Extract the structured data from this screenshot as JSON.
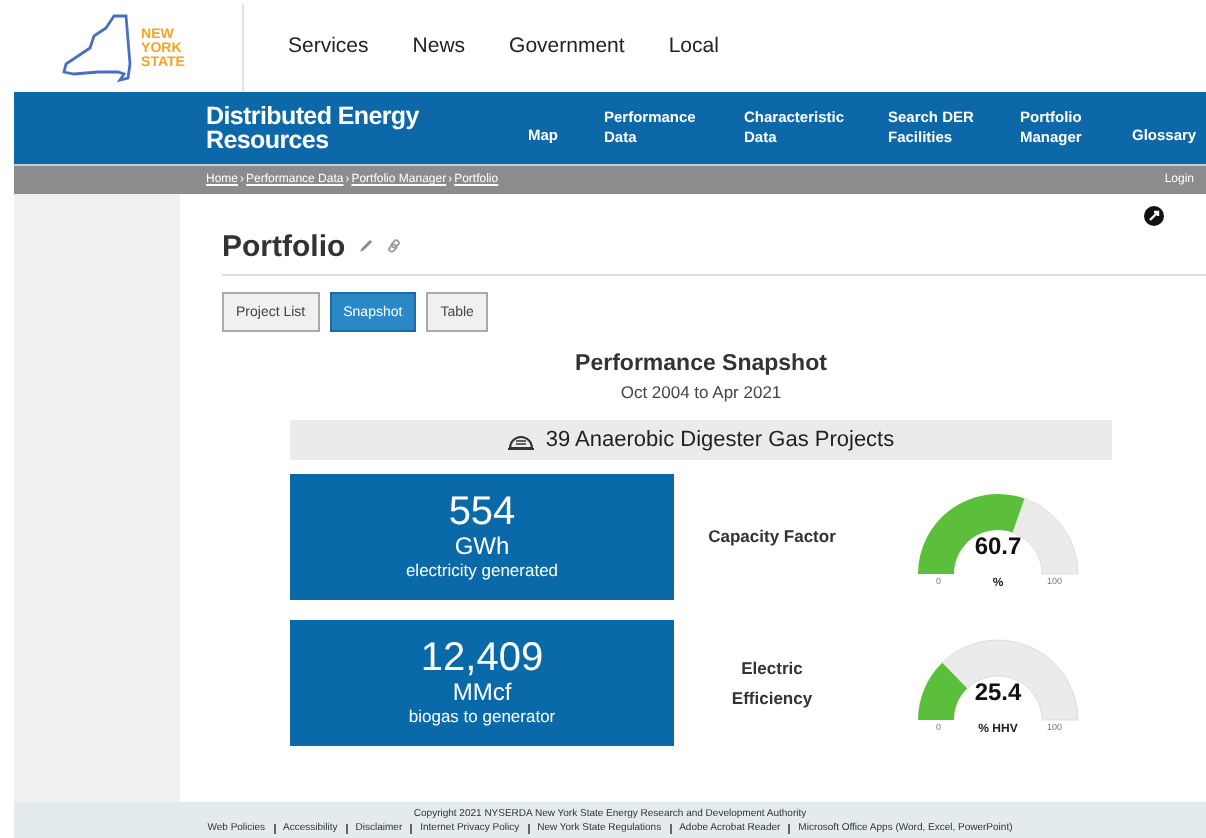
{
  "logo": {
    "lines": [
      "NEW",
      "YORK",
      "STATE"
    ]
  },
  "top_nav": [
    "Services",
    "News",
    "Government",
    "Local"
  ],
  "site_bar": {
    "title": "Distributed Energy Resources",
    "menu": [
      "Map",
      "Performance Data",
      "Characteristic Data",
      "Search DER Facilities",
      "Portfolio Manager",
      "Glossary"
    ]
  },
  "breadcrumb": {
    "separator": "›",
    "items": [
      "Home",
      "Performance Data",
      "Portfolio Manager",
      "Portfolio"
    ],
    "login": "Login"
  },
  "page_title": "Portfolio",
  "tabs": [
    {
      "label": "Project List",
      "selected": false
    },
    {
      "label": "Snapshot",
      "selected": true
    },
    {
      "label": "Table",
      "selected": false
    }
  ],
  "snapshot": {
    "title": "Performance Snapshot",
    "period": "Oct 2004 to Apr 2021",
    "projects": "39 Anaerobic Digester Gas Projects",
    "stats": [
      {
        "value": "554",
        "unit": "GWh",
        "caption": "electricity generated"
      },
      {
        "value": "12,409",
        "unit": "MMcf",
        "caption": "biogas to generator"
      }
    ],
    "gauges": [
      {
        "label": "Capacity Factor",
        "reading": "60.7",
        "unit": "%",
        "min": "0",
        "max": "100",
        "level": 0.607
      },
      {
        "label": "Electric Efficiency",
        "reading": "25.4",
        "unit": "% HHV",
        "min": "0",
        "max": "100",
        "level": 0.254
      }
    ]
  },
  "footer": {
    "copyright": "Copyright 2021 NYSERDA New York State Energy Research and Development Authority",
    "links": [
      "Web Policies",
      "Accessibility",
      "Disclaimer",
      "Internet Privacy Policy",
      "New York State Regulations",
      "Adobe Acrobat Reader",
      "Microsoft Office Apps (Word, Excel, PowerPoint)"
    ]
  }
}
